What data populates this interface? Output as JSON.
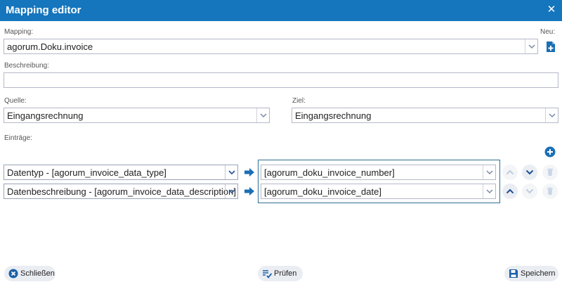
{
  "window": {
    "title": "Mapping editor"
  },
  "mapping": {
    "label": "Mapping:",
    "value": "agorum.Doku.invoice",
    "new_label": "Neu:"
  },
  "description": {
    "label": "Beschreibung:",
    "value": ""
  },
  "source": {
    "label": "Quelle:",
    "value": "Eingangsrechnung"
  },
  "target": {
    "label": "Ziel:",
    "value": "Eingangsrechnung"
  },
  "entries": {
    "label": "Einträge:",
    "rows": [
      {
        "source": "Datentyp - [agorum_invoice_data_type]",
        "target": "[agorum_doku_invoice_number]"
      },
      {
        "source": "Datenbeschreibung - [agorum_invoice_data_description]",
        "target": "[agorum_doku_invoice_date]"
      }
    ]
  },
  "footer": {
    "close_label": "Schließen",
    "check_label": "Prüfen",
    "save_label": "Speichern"
  },
  "colors": {
    "titlebar": "#1575bd",
    "accent": "#1a6fb5",
    "selection_border": "#2e6f94"
  },
  "icons": {
    "close": "close-icon",
    "new": "add-document-icon",
    "add_entry": "plus-circle-icon",
    "arrow": "arrow-right-icon",
    "up": "chevron-up-icon",
    "down": "chevron-down-icon",
    "delete": "trash-icon",
    "check": "check-list-icon",
    "save": "floppy-disk-icon",
    "schliessen": "close-circle-icon"
  }
}
